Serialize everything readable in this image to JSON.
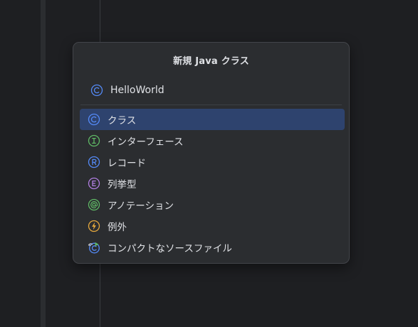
{
  "dialog": {
    "title": "新規 Java クラス",
    "name_input": {
      "value": "HelloWorld",
      "icon": "class-icon"
    },
    "items": [
      {
        "label": "クラス",
        "icon": "class-icon",
        "selected": true
      },
      {
        "label": "インターフェース",
        "icon": "interface-icon",
        "selected": false
      },
      {
        "label": "レコード",
        "icon": "record-icon",
        "selected": false
      },
      {
        "label": "列挙型",
        "icon": "enum-icon",
        "selected": false
      },
      {
        "label": "アノテーション",
        "icon": "annotation-icon",
        "selected": false
      },
      {
        "label": "例外",
        "icon": "exception-icon",
        "selected": false
      },
      {
        "label": "コンパクトなソースファイル",
        "icon": "compact-source-file-icon",
        "selected": false
      }
    ]
  },
  "colors": {
    "background": "#1e1f22",
    "dialog_background": "#2b2d30",
    "selection": "#2e436e",
    "text": "#dfe1e5",
    "class_blue": "#548af7",
    "interface_green": "#5fb865",
    "enum_purple": "#b07ee0",
    "exception_orange": "#e6a93d"
  }
}
